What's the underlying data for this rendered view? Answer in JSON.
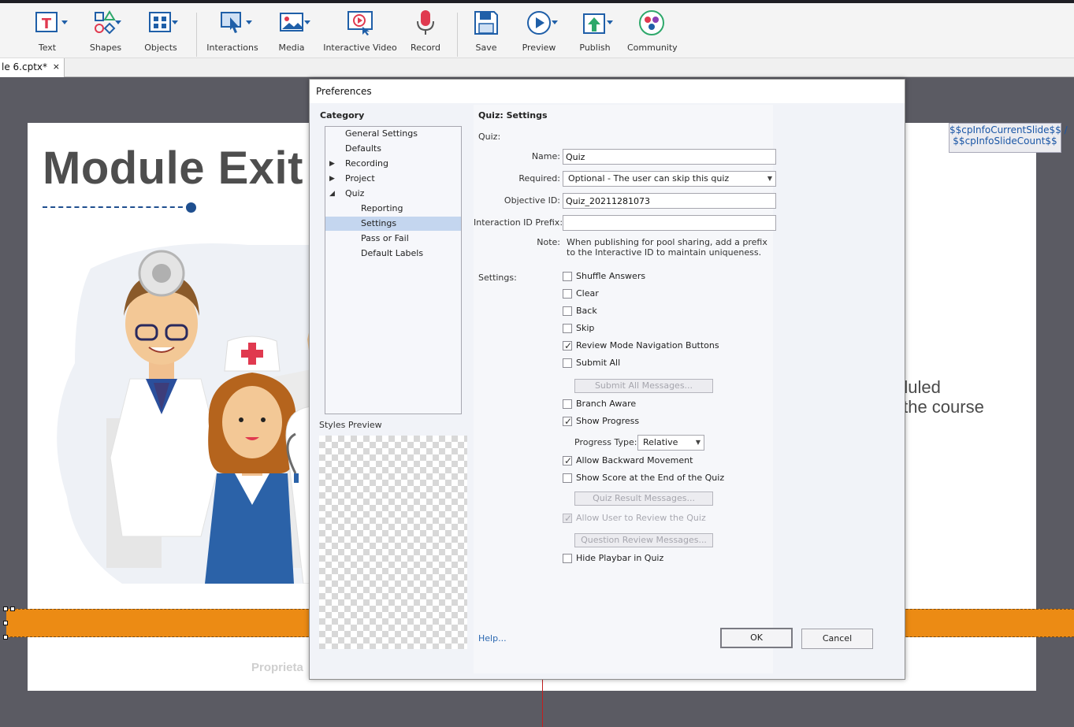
{
  "toolbar": {
    "items": [
      {
        "label": "Text",
        "icon": "text-icon"
      },
      {
        "label": "Shapes",
        "icon": "shapes-icon"
      },
      {
        "label": "Objects",
        "icon": "objects-icon"
      },
      {
        "label": "Interactions",
        "icon": "interactions-icon"
      },
      {
        "label": "Media",
        "icon": "media-icon"
      },
      {
        "label": "Interactive Video",
        "icon": "interactive-video-icon"
      },
      {
        "label": "Record",
        "icon": "microphone-icon"
      },
      {
        "label": "Save",
        "icon": "floppy-disk-icon"
      },
      {
        "label": "Preview",
        "icon": "play-icon"
      },
      {
        "label": "Publish",
        "icon": "publish-icon"
      },
      {
        "label": "Community",
        "icon": "community-icon"
      }
    ],
    "accent": "#1f5fa8",
    "record_color": "#e0394f"
  },
  "doc_tab": {
    "label": "le 6.cptx*",
    "close": "×"
  },
  "slide": {
    "title": "Module Exit",
    "body_text": "duled\n the course",
    "footer_text": "Proprieta",
    "variable_text": "$$cpInfoCurrentSlide$$ /\n$$cpInfoSlideCount$$",
    "accent": "#1f4f8f",
    "bar_color": "#ec8b14"
  },
  "dialog": {
    "title": "Preferences",
    "category_heading": "Category",
    "tree": [
      {
        "label": "General Settings",
        "level": 1,
        "expander": ""
      },
      {
        "label": "Defaults",
        "level": 1,
        "expander": ""
      },
      {
        "label": "Recording",
        "level": 1,
        "expander": "▶"
      },
      {
        "label": "Project",
        "level": 1,
        "expander": "▶"
      },
      {
        "label": "Quiz",
        "level": 1,
        "expander": "◢"
      },
      {
        "label": "Reporting",
        "level": 2,
        "expander": ""
      },
      {
        "label": "Settings",
        "level": 2,
        "expander": "",
        "selected": true
      },
      {
        "label": "Pass or Fail",
        "level": 2,
        "expander": ""
      },
      {
        "label": "Default Labels",
        "level": 2,
        "expander": ""
      }
    ],
    "styles_preview_label": "Styles Preview",
    "section_title": "Quiz: Settings",
    "quiz_label": "Quiz:",
    "name_label": "Name:",
    "name_value": "Quiz",
    "required_label": "Required:",
    "required_value": "Optional - The user can skip this quiz",
    "objective_label": "Objective ID:",
    "objective_value": "Quiz_20211281073",
    "interaction_label": "Interaction ID Prefix:",
    "interaction_value": "",
    "note_label": "Note:",
    "note_text": "When publishing for pool sharing, add a prefix\nto the Interactive ID to maintain uniqueness.",
    "settings_label": "Settings:",
    "checkboxes": [
      {
        "label": "Shuffle Answers",
        "checked": false,
        "disabled": false
      },
      {
        "label": "Clear",
        "checked": false,
        "disabled": false
      },
      {
        "label": "Back",
        "checked": false,
        "disabled": false
      },
      {
        "label": "Skip",
        "checked": false,
        "disabled": false
      },
      {
        "label": "Review Mode Navigation Buttons",
        "checked": true,
        "disabled": false
      },
      {
        "label": "Submit All",
        "checked": false,
        "disabled": false
      },
      {
        "label": "Branch Aware",
        "checked": false,
        "disabled": false
      },
      {
        "label": "Show Progress",
        "checked": true,
        "disabled": false
      },
      {
        "label": "Allow Backward Movement",
        "checked": true,
        "disabled": false
      },
      {
        "label": "Show Score at the End of the Quiz",
        "checked": false,
        "disabled": false
      },
      {
        "label": "Allow User to Review the Quiz",
        "checked": true,
        "disabled": true
      },
      {
        "label": "Hide Playbar in Quiz",
        "checked": false,
        "disabled": false
      }
    ],
    "submit_all_messages": "Submit All Messages...",
    "progress_type_label": "Progress Type:",
    "progress_type_value": "Relative",
    "quiz_result_messages": "Quiz Result Messages...",
    "question_review_messages": "Question Review Messages...",
    "help_label": "Help...",
    "ok_label": "OK",
    "cancel_label": "Cancel",
    "selection_color": "#c4d6ef",
    "link_color": "#2a67b0"
  }
}
